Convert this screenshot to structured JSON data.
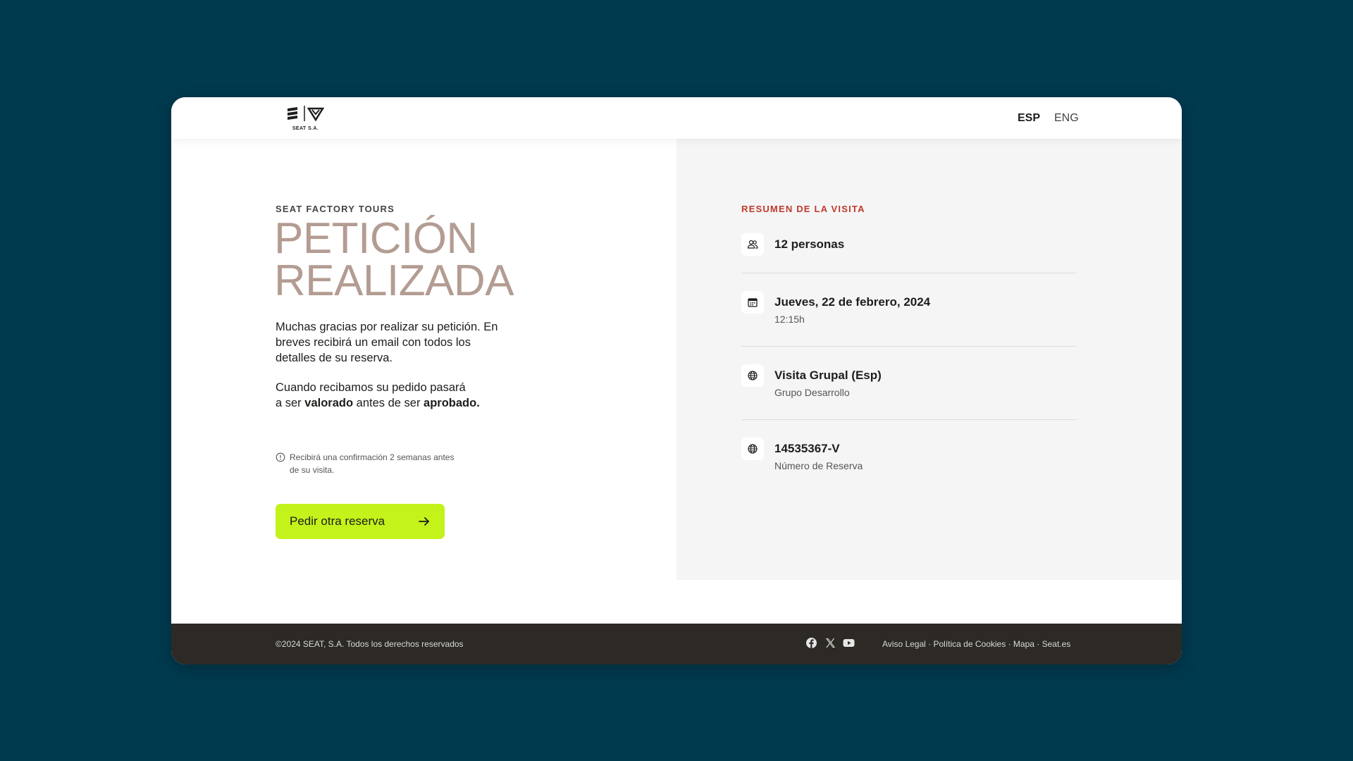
{
  "header": {
    "logo_text": "SEAT S.A.",
    "lang_esp": "ESP",
    "lang_eng": "ENG"
  },
  "confirmation": {
    "eyebrow": "SEAT FACTORY TOURS",
    "title_line1": "PETICIÓN",
    "title_line2": "REALIZADA",
    "para1": "Muchas gracias por realizar su petición. En breves recibirá un email con todos los detalles de su reserva.",
    "para2_part1": "Cuando recibamos su pedido pasará",
    "para2_part2": "a ser ",
    "para2_bold1": "valorado",
    "para2_part3": " antes de ser ",
    "para2_bold2": "aprobado.",
    "note": "Recibirá una confirmación 2 semanas antes de su visita.",
    "cta_label": "Pedir otra reserva"
  },
  "summary": {
    "title": "RESUMEN DE LA VISITA",
    "items": [
      {
        "icon": "people-icon",
        "main": "12 personas",
        "sub": ""
      },
      {
        "icon": "calendar-icon",
        "main": "Jueves, 22 de febrero, 2024",
        "sub": "12:15h"
      },
      {
        "icon": "globe-icon",
        "main": "Visita Grupal (Esp)",
        "sub": "Grupo Desarrollo"
      },
      {
        "icon": "globe-icon",
        "main": "14535367-V",
        "sub": "Número de Reserva"
      }
    ]
  },
  "footer": {
    "copyright": "©2024 SEAT, S.A. Todos los derechos reservados",
    "links": [
      "Aviso Legal",
      "Política de Cookies",
      "Mapa",
      "Seat.es"
    ],
    "separator": " · "
  },
  "colors": {
    "background": "#003a4f",
    "title": "#b39c92",
    "accent_red": "#c0392b",
    "cta": "#c3f31b",
    "footer": "#2d2a26"
  }
}
